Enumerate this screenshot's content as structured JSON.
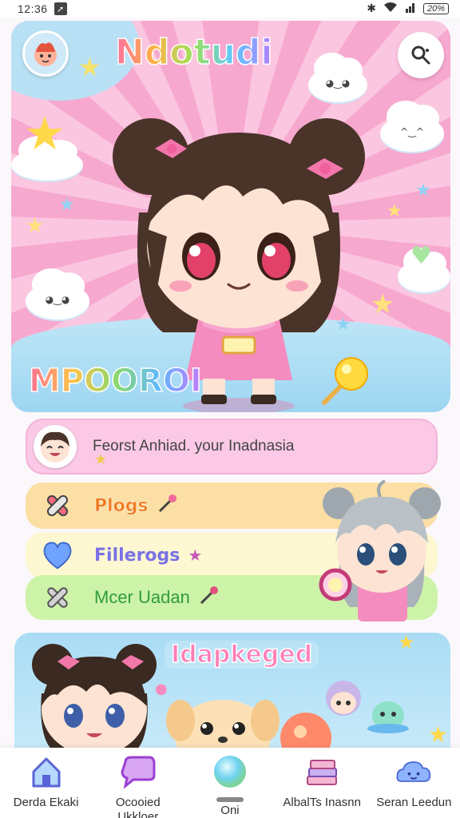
{
  "status_bar": {
    "time": "12:36",
    "notification_glyph": "➚",
    "battery": "20%"
  },
  "hero": {
    "title": "Ndotudi",
    "caption": "MPOOROI"
  },
  "feature_row": {
    "text": "Feorst Anhiad. your Inadnasia"
  },
  "menu": [
    {
      "label": "Plogs",
      "icon": "bandage-icon",
      "color": "#f07a1d"
    },
    {
      "label": "Fillerogs",
      "icon": "heart-icon",
      "color": "#7a72e6"
    },
    {
      "label": "Mcer Uadan",
      "icon": "cross-icon",
      "color": "#2f9c3d"
    }
  ],
  "banner": {
    "title": "Idapkeged"
  },
  "bottom_nav": [
    {
      "label": "Derda Ekaki",
      "icon": "home-icon"
    },
    {
      "label": "Ocooied Ukkloer",
      "icon": "speech-bubble-icon"
    },
    {
      "label": "Oni",
      "icon": "orb-icon"
    },
    {
      "label": "AlbalTs Inasnn",
      "icon": "book-stack-icon"
    },
    {
      "label": "Seran Leedun",
      "icon": "cloud-icon"
    }
  ]
}
